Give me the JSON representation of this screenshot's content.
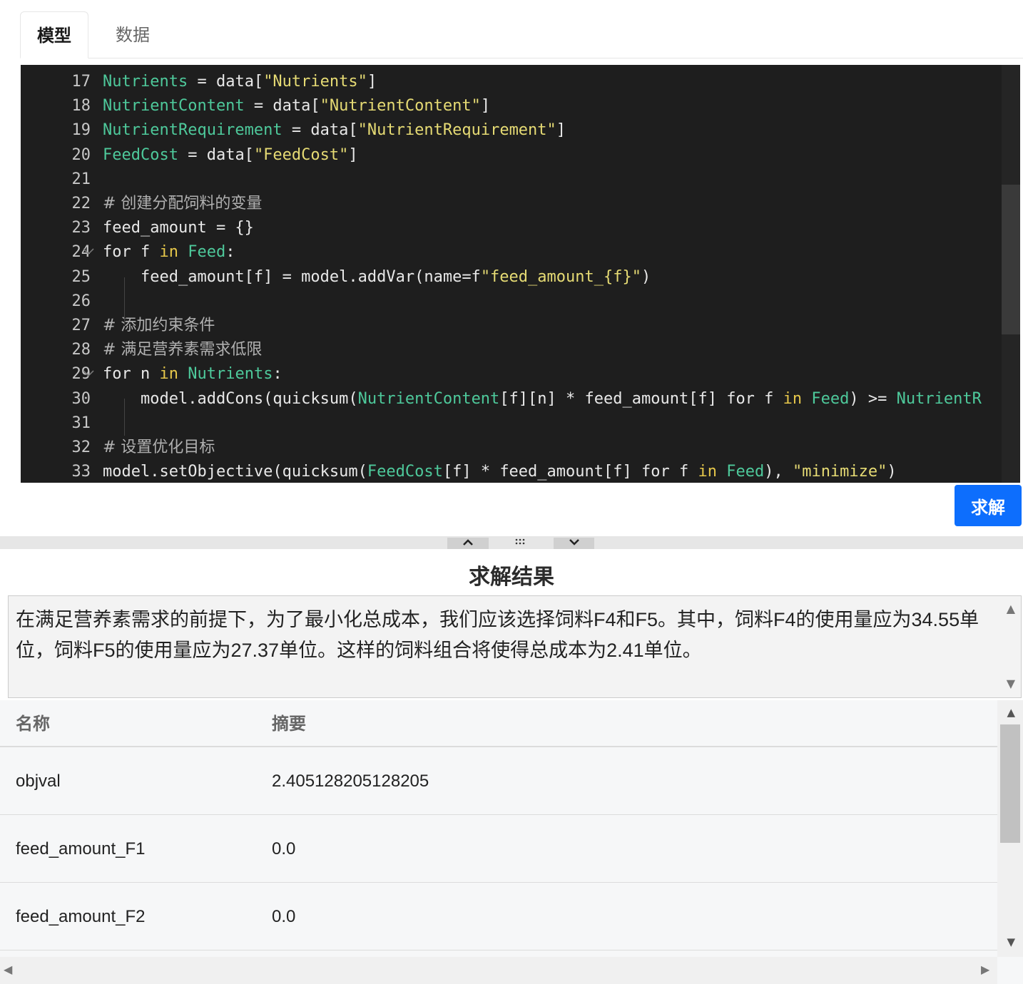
{
  "tabs": [
    {
      "label": "模型",
      "active": true
    },
    {
      "label": "数据",
      "active": false
    }
  ],
  "editor": {
    "lines": [
      {
        "n": "17",
        "tokens": [
          [
            "var",
            "Nutrients"
          ],
          [
            "plain",
            " = data["
          ],
          [
            "str",
            "\"Nutrients\""
          ],
          [
            "plain",
            "]"
          ]
        ]
      },
      {
        "n": "18",
        "tokens": [
          [
            "var",
            "NutrientContent"
          ],
          [
            "plain",
            " = data["
          ],
          [
            "str",
            "\"NutrientContent\""
          ],
          [
            "plain",
            "]"
          ]
        ]
      },
      {
        "n": "19",
        "tokens": [
          [
            "var",
            "NutrientRequirement"
          ],
          [
            "plain",
            " = data["
          ],
          [
            "str",
            "\"NutrientRequirement\""
          ],
          [
            "plain",
            "]"
          ]
        ]
      },
      {
        "n": "20",
        "tokens": [
          [
            "var",
            "FeedCost"
          ],
          [
            "plain",
            " = data["
          ],
          [
            "str",
            "\"FeedCost\""
          ],
          [
            "plain",
            "]"
          ]
        ]
      },
      {
        "n": "21",
        "tokens": []
      },
      {
        "n": "22",
        "tokens": [
          [
            "com",
            "# 创建分配饲料的变量"
          ]
        ]
      },
      {
        "n": "23",
        "tokens": [
          [
            "plain",
            "feed_amount = {}"
          ]
        ]
      },
      {
        "n": "24",
        "fold": true,
        "tokens": [
          [
            "plain",
            "for f "
          ],
          [
            "kw",
            "in"
          ],
          [
            "plain",
            " "
          ],
          [
            "var",
            "Feed"
          ],
          [
            "plain",
            ":"
          ]
        ]
      },
      {
        "n": "25",
        "tokens": [
          [
            "plain",
            "    feed_amount[f] = model.addVar(name=f"
          ],
          [
            "str",
            "\"feed_amount_{f}\""
          ],
          [
            "plain",
            ")"
          ]
        ]
      },
      {
        "n": "26",
        "tokens": []
      },
      {
        "n": "27",
        "tokens": [
          [
            "com",
            "# 添加约束条件"
          ]
        ]
      },
      {
        "n": "28",
        "tokens": [
          [
            "com",
            "# 满足营养素需求低限"
          ]
        ]
      },
      {
        "n": "29",
        "fold": true,
        "tokens": [
          [
            "plain",
            "for n "
          ],
          [
            "kw",
            "in"
          ],
          [
            "plain",
            " "
          ],
          [
            "var",
            "Nutrients"
          ],
          [
            "plain",
            ":"
          ]
        ]
      },
      {
        "n": "30",
        "tokens": [
          [
            "plain",
            "    model.addCons(quicksum("
          ],
          [
            "var",
            "NutrientContent"
          ],
          [
            "plain",
            "[f][n] * feed_amount[f] for f "
          ],
          [
            "kw",
            "in"
          ],
          [
            "plain",
            " "
          ],
          [
            "var",
            "Feed"
          ],
          [
            "plain",
            ") >= "
          ],
          [
            "var",
            "NutrientR"
          ]
        ]
      },
      {
        "n": "31",
        "tokens": []
      },
      {
        "n": "32",
        "tokens": [
          [
            "com",
            "# 设置优化目标"
          ]
        ]
      },
      {
        "n": "33",
        "tokens": [
          [
            "plain",
            "model.setObjective(quicksum("
          ],
          [
            "var",
            "FeedCost"
          ],
          [
            "plain",
            "[f] * feed_amount[f] for f "
          ],
          [
            "kw",
            "in"
          ],
          [
            "plain",
            " "
          ],
          [
            "var",
            "Feed"
          ],
          [
            "plain",
            "), "
          ],
          [
            "str",
            "\"minimize\""
          ],
          [
            "plain",
            ")"
          ]
        ]
      }
    ]
  },
  "solve_button": "求解",
  "splitter": {
    "up_icon": "▲",
    "grip_icon": "⠿",
    "down_icon": "▼"
  },
  "result": {
    "title": "求解结果",
    "summary": "在满足营养素需求的前提下，为了最小化总成本，我们应该选择饲料F4和F5。其中，饲料F4的使用量应为34.55单位，饲料F5的使用量应为27.37单位。这样的饲料组合将使得总成本为2.41单位。"
  },
  "table": {
    "headers": [
      "名称",
      "摘要"
    ],
    "rows": [
      [
        "objval",
        "2.405128205128205"
      ],
      [
        "feed_amount_F1",
        "0.0"
      ],
      [
        "feed_amount_F2",
        "0.0"
      ]
    ]
  },
  "colors": {
    "accent": "#0d6efd",
    "editor_bg": "#1e1e1e",
    "var": "#4ec99b",
    "string": "#e6db74",
    "keyword": "#e6c74a"
  }
}
